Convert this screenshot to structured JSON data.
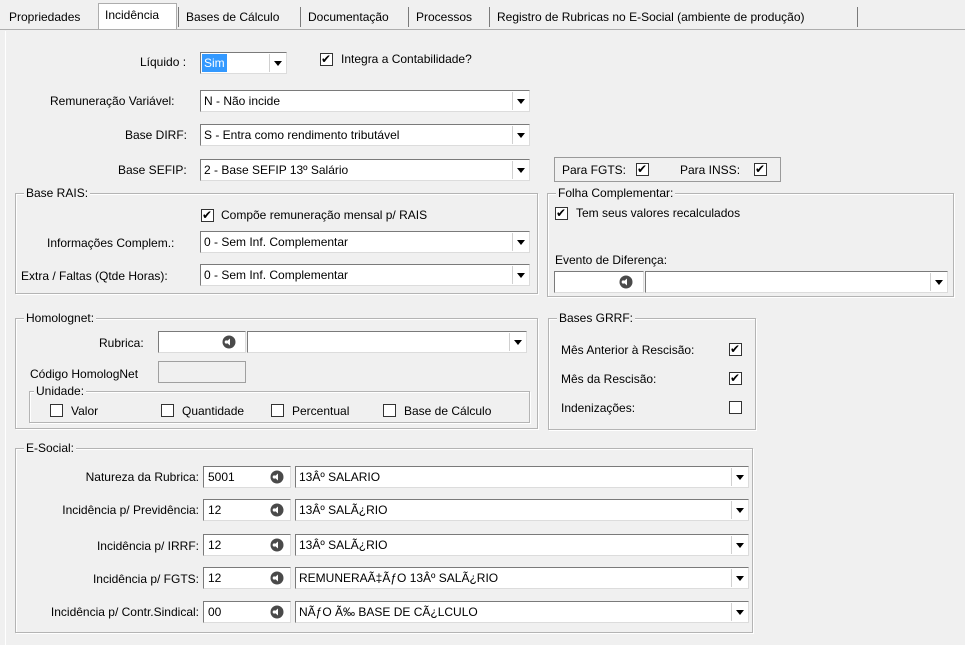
{
  "tabs": [
    {
      "label": "Propriedades",
      "selected": false
    },
    {
      "label": "Incidência",
      "selected": true
    },
    {
      "label": "Bases de Cálculo",
      "selected": false
    },
    {
      "label": "Documentação",
      "selected": false
    },
    {
      "label": "Processos",
      "selected": false
    },
    {
      "label": "Registro de Rubricas no E-Social (ambiente de produção)",
      "selected": false
    }
  ],
  "liquido": {
    "label": "Líquido :",
    "value": "Sim"
  },
  "integra": {
    "label": "Integra a Contabilidade?",
    "checked": true
  },
  "remuneracao": {
    "label": "Remuneração Variável:",
    "value": "N - Não incide"
  },
  "base_dirf": {
    "label": "Base DIRF:",
    "value": "S - Entra como rendimento tributável"
  },
  "base_sefip": {
    "label": "Base SEFIP:",
    "value": "2 - Base SEFIP 13º Salário"
  },
  "para_fgts": {
    "label": "Para FGTS:",
    "checked": true
  },
  "para_inss": {
    "label": "Para INSS:",
    "checked": true
  },
  "base_rais": {
    "caption": "Base RAIS:",
    "compoe": {
      "label": "Compõe remuneração mensal p/ RAIS",
      "checked": true
    },
    "info_label": "Informações Complem.:",
    "info_value": "0 - Sem Inf. Complementar",
    "extra_label": "Extra / Faltas (Qtde Horas):",
    "extra_value": "0 - Sem Inf. Complementar"
  },
  "folha": {
    "caption": "Folha Complementar:",
    "recalc": {
      "label": "Tem seus valores recalculados",
      "checked": true
    },
    "evento_label": "Evento de Diferença:",
    "evento_code": "",
    "evento_desc": ""
  },
  "homolognet": {
    "caption": "Homolognet:",
    "rubrica_label": "Rubrica:",
    "rubrica_code": "",
    "rubrica_desc": "",
    "codigo_label": "Código HomologNet",
    "codigo_value": "",
    "unidade_caption": "Unidade:",
    "valor": {
      "label": "Valor",
      "checked": false
    },
    "quantidade": {
      "label": "Quantidade",
      "checked": false
    },
    "percentual": {
      "label": "Percentual",
      "checked": false
    },
    "base_calc": {
      "label": "Base de Cálculo",
      "checked": false
    }
  },
  "bases_grrf": {
    "caption": "Bases GRRF:",
    "mes_anterior": {
      "label": "Mês Anterior à Rescisão:",
      "checked": true
    },
    "mes_rescisao": {
      "label": "Mês da Rescisão:",
      "checked": true
    },
    "indenizacoes": {
      "label": "Indenizações:",
      "checked": false
    }
  },
  "esocial": {
    "caption": "E-Social:",
    "rows": [
      {
        "label": "Natureza da Rubrica:",
        "code": "5001",
        "desc": "13Âº SALARIO"
      },
      {
        "label": "Incidência p/ Previdência:",
        "code": "12",
        "desc": "13Âº SALÃ¿RIO"
      },
      {
        "label": "Incidência p/ IRRF:",
        "code": "12",
        "desc": "13Âº SALÃ¿RIO"
      },
      {
        "label": "Incidência p/ FGTS:",
        "code": "12",
        "desc": "REMUNERAÃ‡ÃƒO 13Âº SALÃ¿RIO"
      },
      {
        "label": "Incidência p/ Contr.Sindical:",
        "code": "00",
        "desc": "NÃƒO Ã‰ BASE DE CÃ¿LCULO"
      }
    ]
  }
}
